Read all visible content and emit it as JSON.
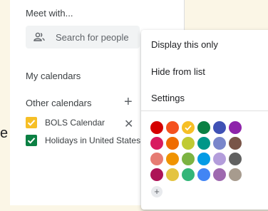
{
  "sidebar": {
    "edge_glyph": "e",
    "meet_title": "Meet with...",
    "search_placeholder": "Search for people",
    "my_calendars": "My calendars",
    "other_calendars": "Other calendars",
    "add_symbol": "+",
    "remove_symbol": "✕",
    "calendars": [
      {
        "label": "BOLS Calendar",
        "color": "#f6bf26",
        "checked": true
      },
      {
        "label": "Holidays in United States",
        "color": "#0b8043",
        "checked": true
      }
    ]
  },
  "menu": {
    "items": [
      {
        "label": "Display this only"
      },
      {
        "label": "Hide from list"
      },
      {
        "label": "Settings"
      }
    ],
    "palette": [
      [
        "#d50000",
        "#f4511e",
        "#f6bf26",
        "#0b8043",
        "#3f51b5",
        "#8e24aa"
      ],
      [
        "#d81b60",
        "#ef6c00",
        "#c0ca33",
        "#009688",
        "#7986cb",
        "#795548"
      ],
      [
        "#e67c73",
        "#f09300",
        "#7cb342",
        "#039be5",
        "#b39ddb",
        "#616161"
      ],
      [
        "#ad1457",
        "#e4c441",
        "#33b679",
        "#4285f4",
        "#9e69af",
        "#a79b8e"
      ]
    ],
    "selected_color": "#f6bf26",
    "add_color_symbol": "+"
  }
}
